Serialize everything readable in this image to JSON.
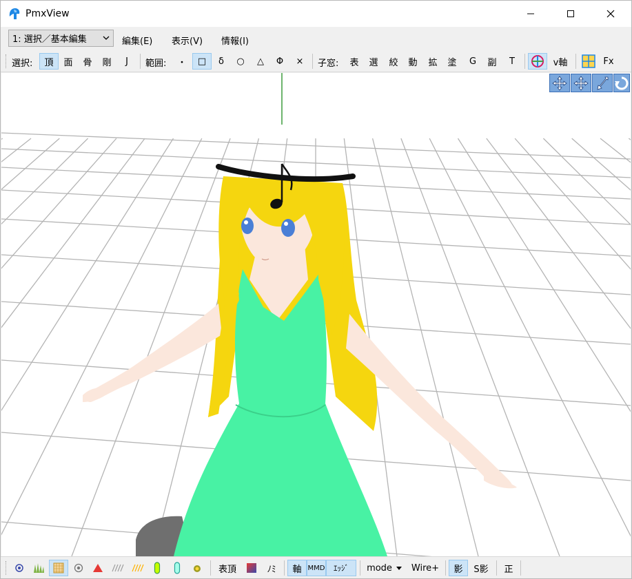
{
  "window": {
    "title": "PmxView",
    "app_icon": "pmxview-app-icon",
    "controls": {
      "minimize_icon": "minimize-icon",
      "maximize_icon": "maximize-icon",
      "close_icon": "close-icon"
    }
  },
  "menubar": {
    "mode_select": {
      "value": "1: 選択／基本編集",
      "icon": "chevron-down-icon"
    },
    "items": [
      "編集(E)",
      "表示(V)",
      "情報(I)"
    ]
  },
  "toolbar": {
    "select_label": "選択:",
    "select_items": [
      "頂",
      "面",
      "骨",
      "剛",
      "J"
    ],
    "select_active": "頂",
    "range_label": "範囲:",
    "range_items": [
      "・",
      "□",
      "δ",
      "○",
      "△",
      "Φ",
      "×"
    ],
    "range_active": "□",
    "child_label": "子窓:",
    "child_items": [
      "表",
      "選",
      "絞",
      "動",
      "拡",
      "塗",
      "G",
      "副",
      "T"
    ],
    "axis_icon": "axis-gizmo-icon",
    "v_axis_label": "v軸",
    "fx_icon": "grid-quad-icon",
    "fx_label": "Fx"
  },
  "viewport": {
    "nav_buttons": [
      "move-xy-icon",
      "move-xz-icon",
      "zoom-icon",
      "rotate-icon"
    ],
    "background_color": "#ffffff",
    "grid_color": "#b4b4b4",
    "model": {
      "hair_color": "#f5d60f",
      "dress_color": "#48f2a4",
      "skin_color": "#fbe7dc",
      "eye_color": "#4a7fd6",
      "hat_color": "#111111",
      "note_icon": "music-note-icon"
    }
  },
  "bottombar": {
    "icons": [
      "vertex-dot-icon",
      "grass-icon",
      "texture-grid-icon",
      "circle-target-icon",
      "red-triangle-icon",
      "hatch-icon",
      "yellow-hatch-icon",
      "green-capsule-icon",
      "cyan-capsule-icon",
      "bug-icon"
    ],
    "icons_active": "texture-grid-icon",
    "table_vertex_label": "表頂",
    "color_icon": "color-swatch-icon",
    "no_label": "ﾉﾐ",
    "axis_label": "軸",
    "mmd_label": "MMD",
    "edge_label": "ｴｯｼﾞ",
    "mode_label": "mode",
    "mode_icon": "caret-down-icon",
    "wire_label": "Wire+",
    "shadow_label": "影",
    "s_shadow_label": "S影",
    "ortho_label": "正"
  }
}
